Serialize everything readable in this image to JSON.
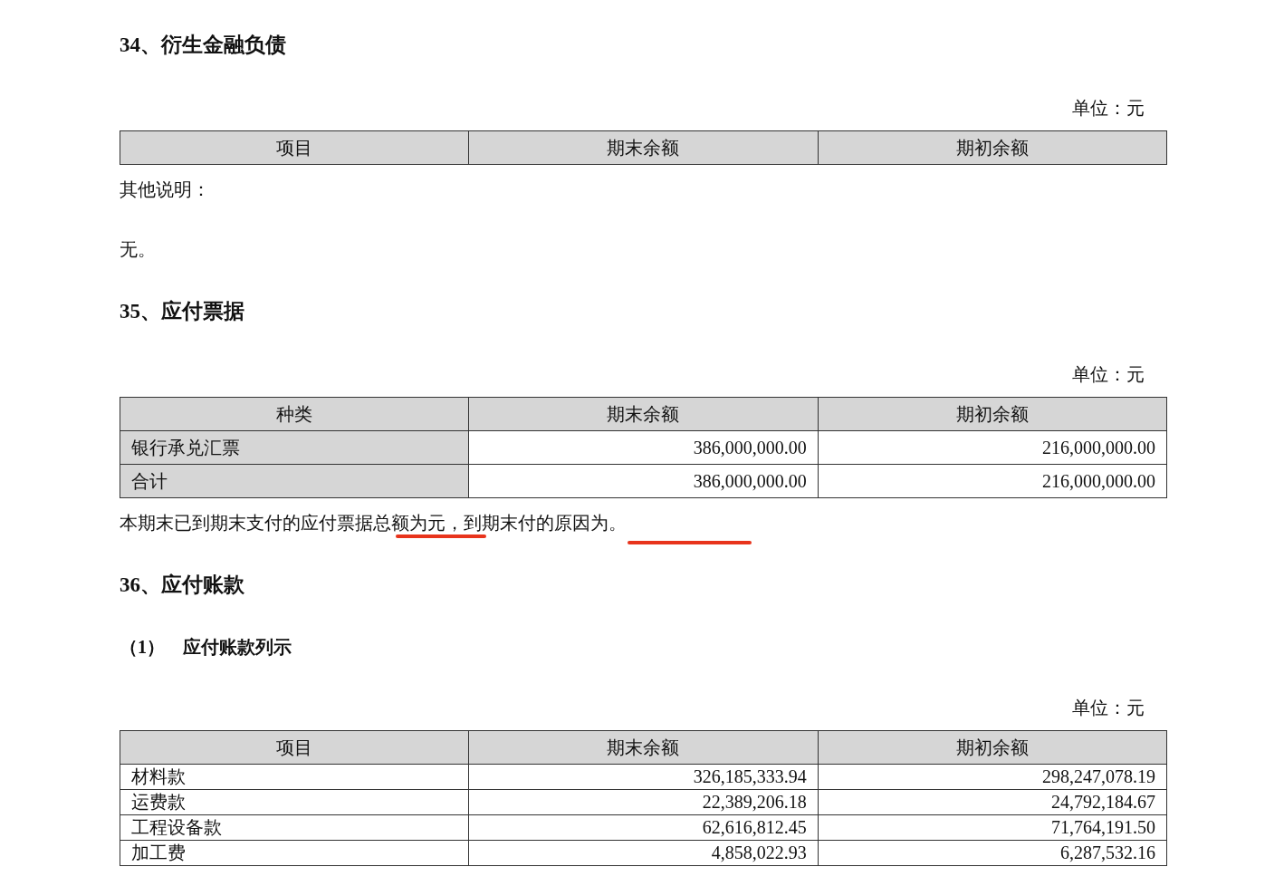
{
  "blocks": [
    {
      "kind": "heading",
      "text": "34、衍生金融负债"
    },
    {
      "kind": "unit",
      "text": "单位：元"
    },
    {
      "kind": "table",
      "columns": [
        "项目",
        "期末余额",
        "期初余额"
      ]
    },
    {
      "kind": "paragraph",
      "text": "其他说明："
    },
    {
      "kind": "paragraph",
      "text": "无。"
    },
    {
      "kind": "heading",
      "text": "35、应付票据"
    },
    {
      "kind": "unit",
      "text": "单位：元"
    },
    {
      "kind": "table",
      "dense": false,
      "shaded_labels": true,
      "columns": [
        "种类",
        "期末余额",
        "期初余额"
      ],
      "rows": [
        [
          "银行承兑汇票",
          "386,000,000.00",
          "216,000,000.00"
        ],
        [
          "合计",
          "386,000,000.00",
          "216,000,000.00"
        ]
      ]
    },
    {
      "kind": "marked_paragraph",
      "text": "本期末已到期末支付的应付票据总额为元，到期末付的原因为。"
    },
    {
      "kind": "heading",
      "text": "36、应付账款"
    },
    {
      "kind": "subheading",
      "text": "（1）　应付账款列示"
    },
    {
      "kind": "unit",
      "text": "单位：元"
    },
    {
      "kind": "table",
      "dense": true,
      "shaded_labels": false,
      "columns": [
        "项目",
        "期末余额",
        "期初余额"
      ],
      "rows": [
        [
          "材料款",
          "326,185,333.94",
          "298,247,078.19"
        ],
        [
          "运费款",
          "22,389,206.18",
          "24,792,184.67"
        ],
        [
          "工程设备款",
          "62,616,812.45",
          "71,764,191.50"
        ],
        [
          "加工费",
          "4,858,022.93",
          "6,287,532.16"
        ]
      ]
    }
  ]
}
